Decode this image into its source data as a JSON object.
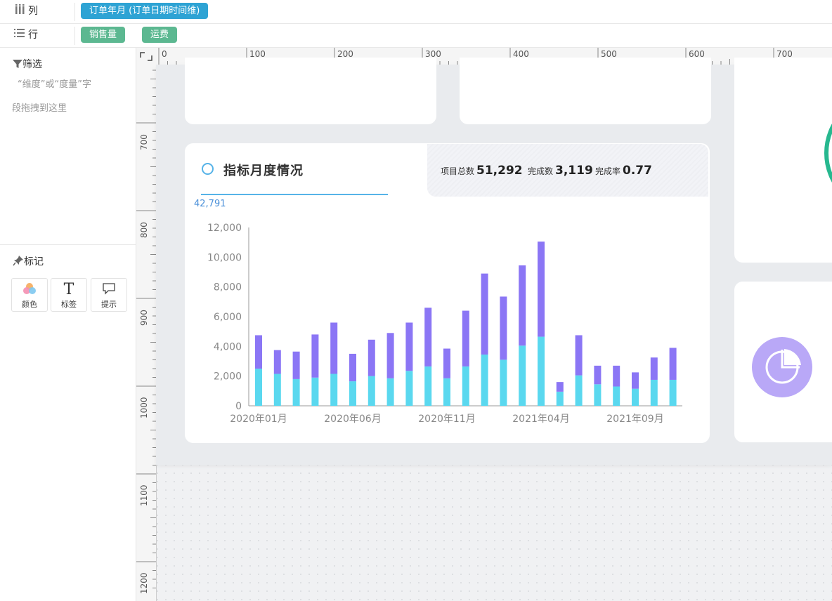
{
  "shelves": {
    "columns": {
      "icon": "column-bars-icon",
      "label": "列",
      "pills": [
        "订单年月 (订单日期时间维)"
      ]
    },
    "rows": {
      "icon": "list-icon",
      "label": "行",
      "pills": [
        "销售量",
        "运费"
      ]
    }
  },
  "filter": {
    "icon": "filter-icon",
    "title": "筛选",
    "hint_line1": "“维度”或“度量”字",
    "hint_line2": "段拖拽到这里"
  },
  "marks": {
    "icon": "pin-icon",
    "title": "标记",
    "buttons": [
      {
        "icon": "palette-icon",
        "label": "颜色"
      },
      {
        "icon": "text-t-icon",
        "label": "标签"
      },
      {
        "icon": "speech-bubble-icon",
        "label": "提示"
      }
    ]
  },
  "ruler": {
    "top": [
      "0",
      "100",
      "200",
      "300",
      "400",
      "500",
      "600",
      "700"
    ],
    "left": [
      "700",
      "800",
      "900",
      "1000",
      "1100",
      "1200"
    ]
  },
  "card": {
    "title": "指标月度情况",
    "stats": [
      {
        "label": "项目总数",
        "value": "51,292"
      },
      {
        "label": "完成数",
        "value": "3,119"
      },
      {
        "label": "完成率",
        "value": "0.77"
      }
    ],
    "peak_label": "42,791"
  },
  "colors": {
    "series_bottom": "#5ad8ef",
    "series_top": "#8b76f5",
    "accent": "#56b3e8",
    "pie_bg": "#b9a8f7"
  },
  "chart_data": {
    "type": "bar",
    "stacked": true,
    "categories": [
      "2020年01月",
      "2020年02月",
      "2020年03月",
      "2020年04月",
      "2020年05月",
      "2020年06月",
      "2020年07月",
      "2020年08月",
      "2020年09月",
      "2020年10月",
      "2020年11月",
      "2020年12月",
      "2021年01月",
      "2021年02月",
      "2021年03月",
      "2021年04月",
      "2021年05月",
      "2021年06月",
      "2021年07月",
      "2021年08月",
      "2021年09月",
      "2021年10月",
      "2021年11月"
    ],
    "x_tick_labels": [
      "2020年01月",
      "2020年06月",
      "2020年11月",
      "2021年04月",
      "2021年09月"
    ],
    "series": [
      {
        "values": [
          2500,
          2150,
          1800,
          1900,
          2150,
          1650,
          2000,
          1850,
          2350,
          2650,
          1850,
          2650,
          3450,
          3100,
          4050,
          4650,
          950,
          2050,
          1450,
          1300,
          1150,
          1750,
          1750
        ]
      },
      {
        "values": [
          2250,
          1600,
          1850,
          2900,
          3450,
          1850,
          2450,
          3050,
          3250,
          3950,
          2000,
          3750,
          5450,
          4250,
          5400,
          6400,
          650,
          2700,
          1250,
          1400,
          1100,
          1500,
          2150
        ]
      }
    ],
    "y_ticks": [
      "0",
      "2,000",
      "4,000",
      "6,000",
      "8,000",
      "10,000",
      "12,000"
    ],
    "ylim": [
      0,
      12000
    ],
    "grid": false,
    "legend": "none"
  }
}
